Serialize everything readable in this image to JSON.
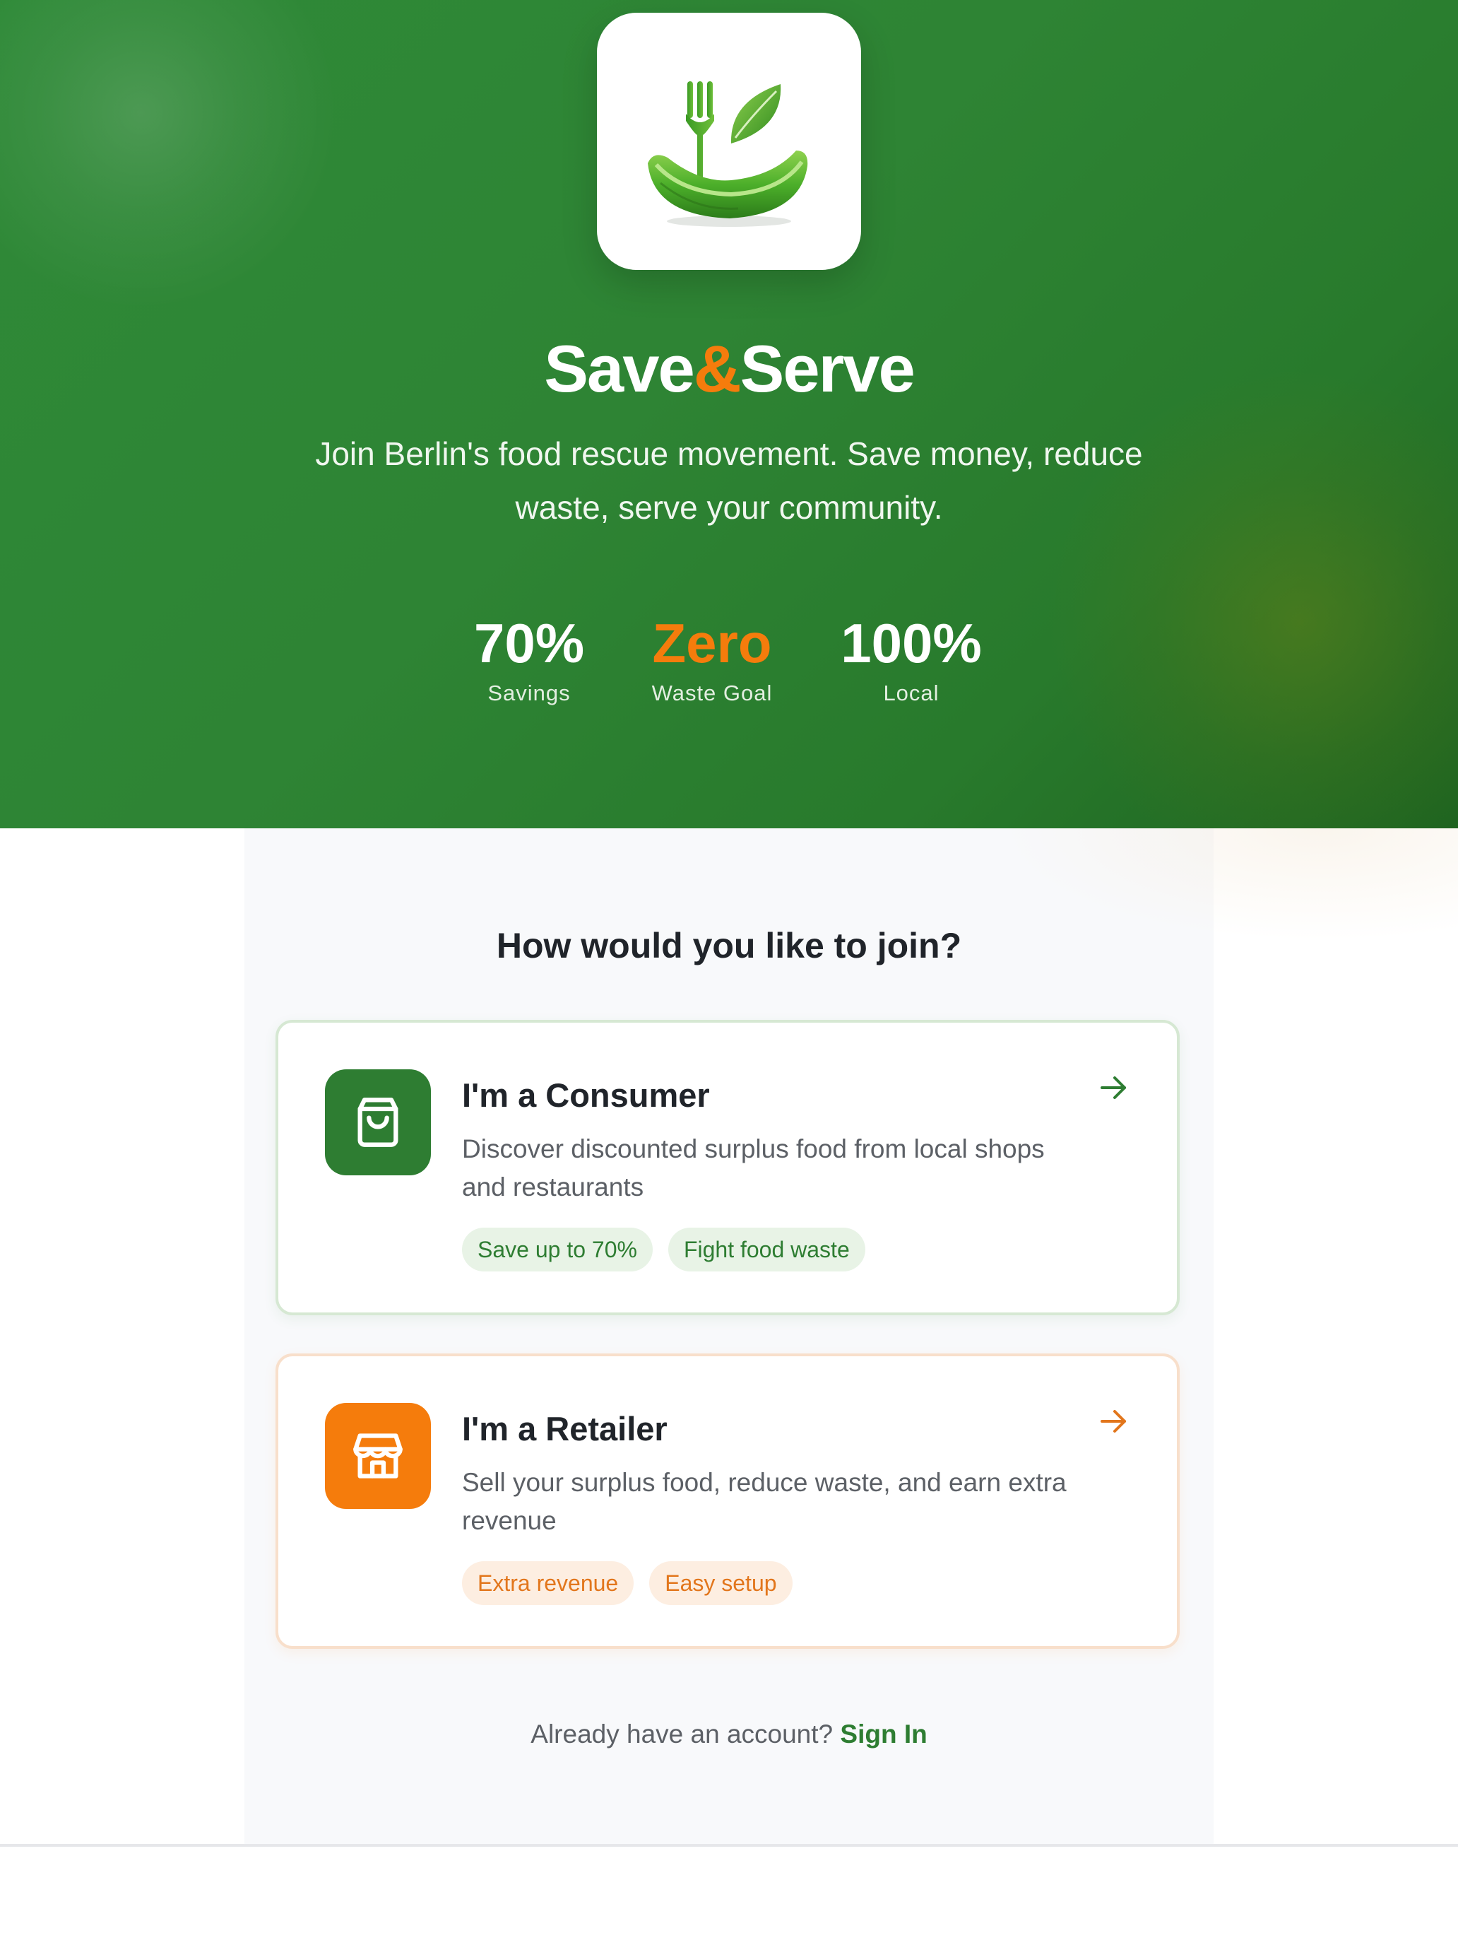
{
  "brand": {
    "name_part1": "Save",
    "name_amp": "&",
    "name_part2": "Serve",
    "tagline": "Join Berlin's food rescue movement. Save money, reduce waste, serve your community.",
    "logo_icon": "fork-leaf-bowl-icon"
  },
  "stats": [
    {
      "value": "70%",
      "label": "Savings"
    },
    {
      "value": "Zero",
      "label": "Waste Goal"
    },
    {
      "value": "100%",
      "label": "Local"
    }
  ],
  "join": {
    "title": "How would you like to join?"
  },
  "cards": {
    "consumer": {
      "icon": "shopping-bag-icon",
      "title": "I'm a Consumer",
      "description": "Discover discounted surplus food from local shops and restaurants",
      "chips": [
        "Save up to 70%",
        "Fight food waste"
      ],
      "arrow_icon": "arrow-right-icon"
    },
    "retailer": {
      "icon": "storefront-icon",
      "title": "I'm a Retailer",
      "description": "Sell your surplus food, reduce waste, and earn extra revenue",
      "chips": [
        "Extra revenue",
        "Easy setup"
      ],
      "arrow_icon": "arrow-right-icon"
    }
  },
  "signin": {
    "prompt": "Already have an account?",
    "link": "Sign In"
  },
  "colors": {
    "primary_green": "#2e7d32",
    "accent_orange": "#f57c0c",
    "text_dark": "#20242a",
    "text_muted": "#5c6066"
  }
}
